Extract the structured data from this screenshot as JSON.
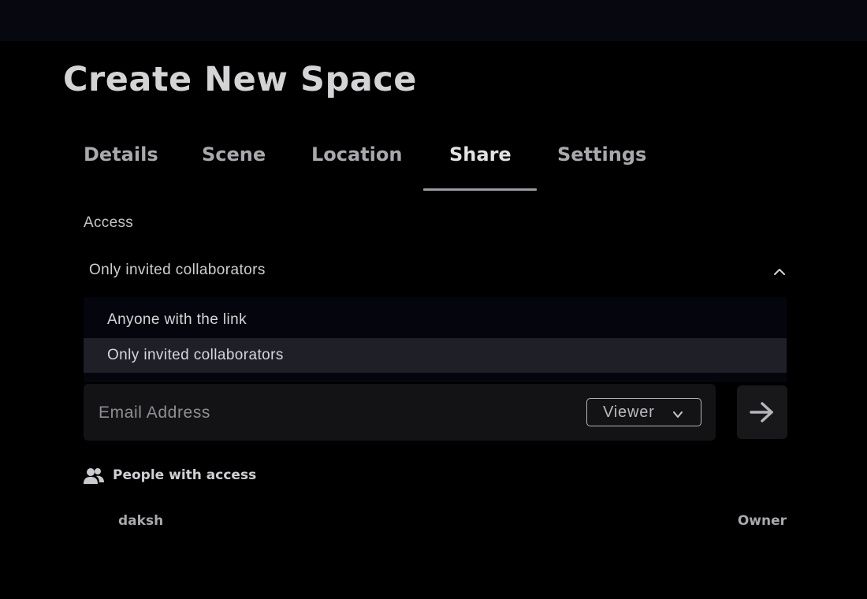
{
  "page": {
    "title": "Create New Space"
  },
  "tabs": [
    {
      "label": "Details"
    },
    {
      "label": "Scene"
    },
    {
      "label": "Location"
    },
    {
      "label": "Share",
      "active": true
    },
    {
      "label": "Settings"
    }
  ],
  "access": {
    "label": "Access",
    "selected": "Only invited collaborators",
    "chevron_icon": "chevron-up-icon",
    "options": [
      {
        "label": "Anyone with the link"
      },
      {
        "label": "Only invited collaborators",
        "selected": true
      }
    ]
  },
  "invite": {
    "email_placeholder": "Email Address",
    "email_value": "",
    "role": "Viewer",
    "role_icon": "chevron-down-icon",
    "send_icon": "arrow-right-icon"
  },
  "people": {
    "icon": "people-icon",
    "title": "People with access",
    "list": [
      {
        "name": "daksh",
        "role": "Owner"
      }
    ]
  },
  "colors": {
    "background": "#000000",
    "topbar": "#07070f",
    "dropdown_bg": "#05050d",
    "selected_option_bg": "#1f1f28",
    "input_bg": "#131316"
  }
}
